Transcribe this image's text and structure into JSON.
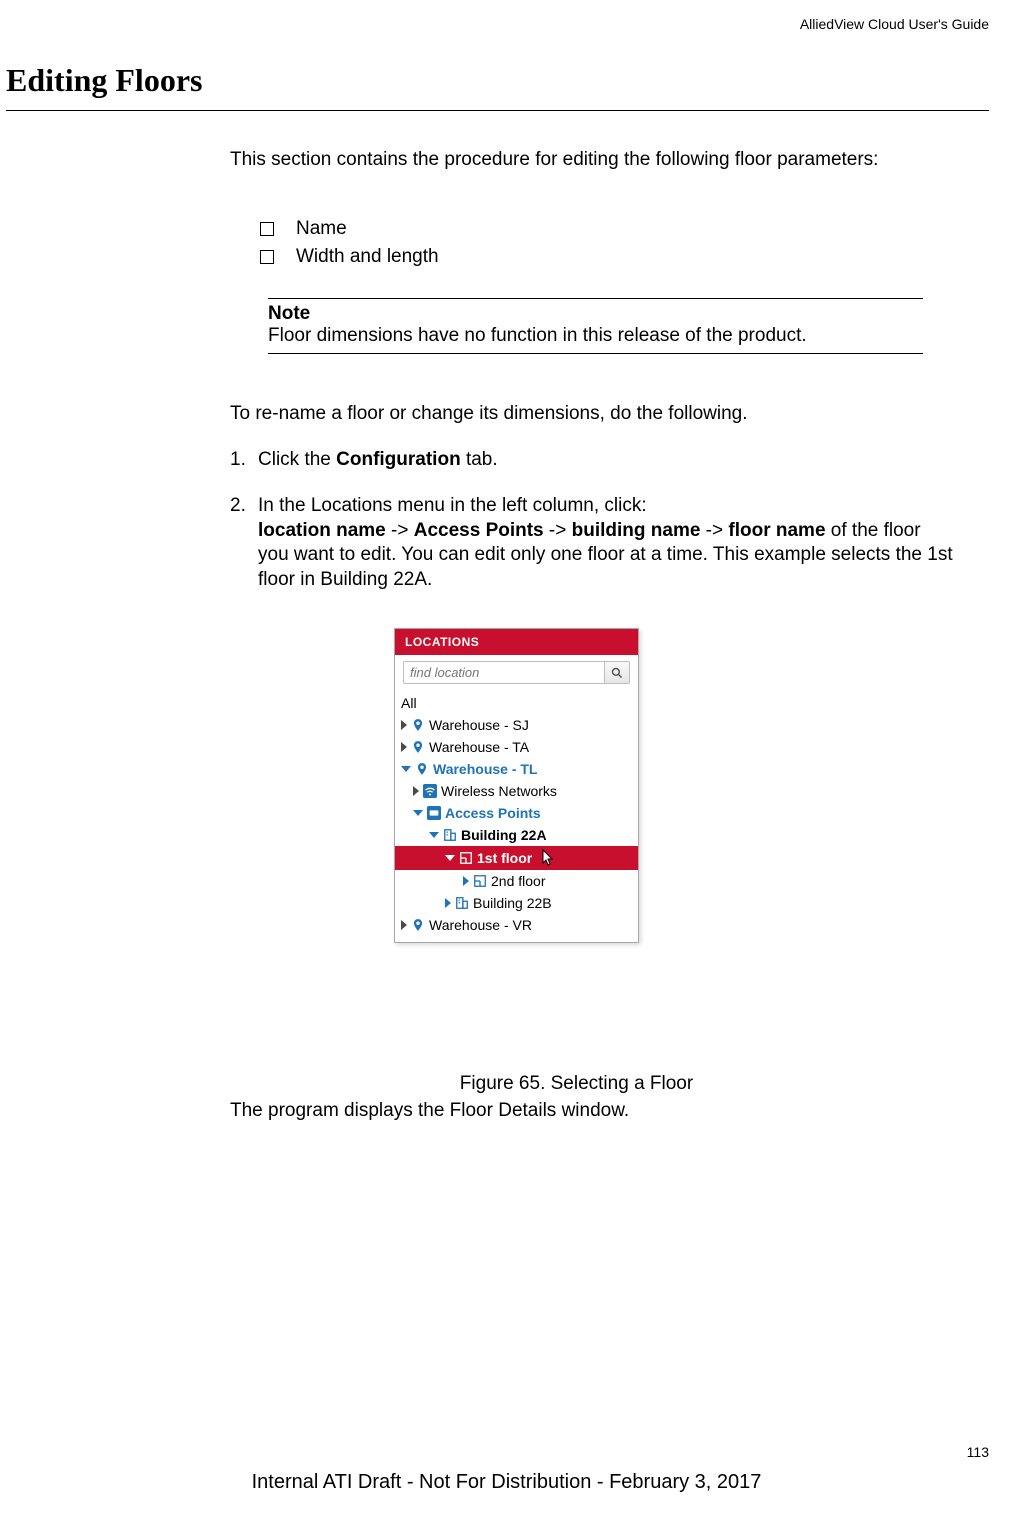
{
  "header_name": "AlliedView Cloud User's Guide",
  "section_title": "Editing Floors",
  "intro": "This section contains the procedure for editing the following floor parameters:",
  "params": [
    "Name",
    "Width and length"
  ],
  "note_title": "Note",
  "note_text": "Floor dimensions have no function in this release of the product.",
  "to_rename": "To re-name a floor or change its dimensions, do the following.",
  "step1_num": "1.",
  "step1_a": "Click the ",
  "step1_b": "Configuration",
  "step1_c": " tab.",
  "step2_num": "2.",
  "step2_line1": "In the Locations menu in the left column, click:",
  "step2_line2a": "location name",
  "step2_line2b": " -> ",
  "step2_line2c": "Access Points",
  "step2_line2d": " -> ",
  "step2_line2e": "building name",
  "step2_line2f": " -> ",
  "step2_line2g": "floor name",
  "step2_line3": "of the floor you want to edit. You can edit only one floor at a time. This example selects the 1st floor in Building 22A.",
  "panel": {
    "header": "LOCATIONS",
    "search_placeholder": "find location",
    "all": "All",
    "items": {
      "wh_sj": "Warehouse - SJ",
      "wh_ta": "Warehouse - TA",
      "wh_tl": "Warehouse - TL",
      "wireless": "Wireless Networks",
      "aps": "Access Points",
      "b22a": "Building 22A",
      "f1": "1st floor",
      "f2": "2nd floor",
      "b22b": "Building 22B",
      "wh_vr": "Warehouse - VR"
    }
  },
  "figure_caption": "Figure 65. Selecting a Floor",
  "program_displays": "The program displays the Floor Details window.",
  "page_number": "113",
  "footer": "Internal ATI Draft - Not For Distribution - February 3, 2017"
}
